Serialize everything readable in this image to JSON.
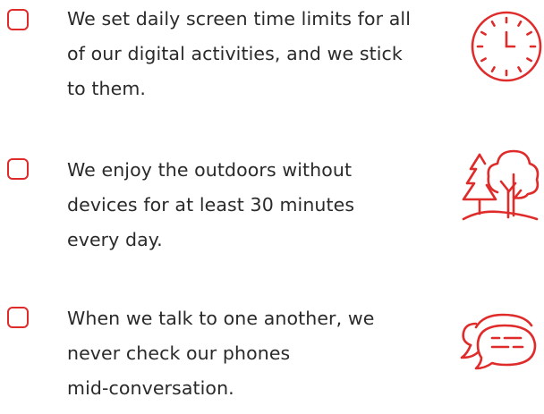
{
  "accent_color": "#e02b2b",
  "text_color": "#2a2a2a",
  "items": [
    {
      "lines": [
        "We set daily screen time limits for all",
        "of our digital activities, and we stick",
        "to them."
      ],
      "checked": false,
      "icon": "clock-icon"
    },
    {
      "lines": [
        "We enjoy the outdoors without",
        "devices for at least 30 minutes",
        "every day."
      ],
      "checked": false,
      "icon": "trees-icon"
    },
    {
      "lines": [
        "When we talk to one another, we",
        "never check our phones",
        "mid-conversation."
      ],
      "checked": false,
      "icon": "chat-bubbles-icon"
    }
  ]
}
